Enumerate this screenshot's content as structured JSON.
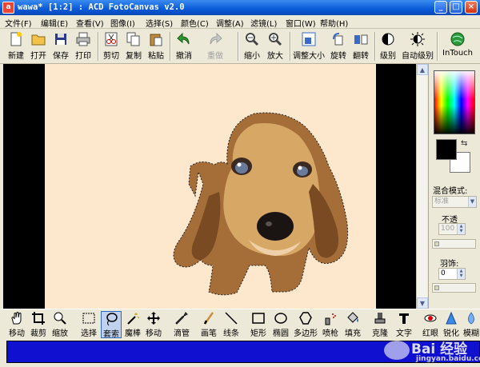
{
  "window": {
    "title": "wawa* [1:2] : ACD FotoCanvas v2.0",
    "app_icon_letter": "a"
  },
  "window_buttons": {
    "minimize": "_",
    "maximize": "□",
    "close": "×"
  },
  "menu": [
    "文件(F)",
    "编辑(E)",
    "查看(V)",
    "图像(I)",
    "选择(S)",
    "颜色(C)",
    "调整(A)",
    "滤镜(L)",
    "窗口(W)",
    "帮助(H)"
  ],
  "toolbar": [
    {
      "label": "新建",
      "icon": "new-file-icon",
      "enabled": true
    },
    {
      "label": "打开",
      "icon": "open-folder-icon",
      "enabled": true
    },
    {
      "label": "保存",
      "icon": "save-disk-icon",
      "enabled": true
    },
    {
      "label": "打印",
      "icon": "printer-icon",
      "enabled": true
    },
    {
      "label": "剪切",
      "icon": "cut-icon",
      "enabled": true
    },
    {
      "label": "复制",
      "icon": "copy-icon",
      "enabled": true
    },
    {
      "label": "粘贴",
      "icon": "paste-icon",
      "enabled": true
    },
    {
      "label": "撤消",
      "icon": "undo-icon",
      "enabled": true
    },
    {
      "label": "重做",
      "icon": "redo-icon",
      "enabled": false
    },
    {
      "label": "缩小",
      "icon": "zoom-out-icon",
      "enabled": true
    },
    {
      "label": "放大",
      "icon": "zoom-in-icon",
      "enabled": true
    },
    {
      "label": "调整大小",
      "icon": "resize-icon",
      "enabled": true
    },
    {
      "label": "旋转",
      "icon": "rotate-icon",
      "enabled": true
    },
    {
      "label": "翻转",
      "icon": "flip-icon",
      "enabled": true
    },
    {
      "label": "级别",
      "icon": "levels-icon",
      "enabled": true
    },
    {
      "label": "自动级别",
      "icon": "auto-levels-icon",
      "enabled": true
    },
    {
      "label": "InTouch",
      "icon": "intouch-globe-icon",
      "enabled": true
    }
  ],
  "right_panel": {
    "blend_mode_label": "混合模式:",
    "blend_mode_value": "标准",
    "opacity_label": "不透",
    "opacity_value": "100",
    "feather_label": "羽饰:",
    "feather_value": "0",
    "fg_color": "#000000",
    "bg_color": "#ffffff"
  },
  "tools": [
    {
      "label": "移动",
      "icon": "hand-icon"
    },
    {
      "label": "裁剪",
      "icon": "crop-icon"
    },
    {
      "label": "缩放",
      "icon": "magnifier-icon"
    },
    {
      "label": "选择",
      "icon": "marquee-select-icon"
    },
    {
      "label": "套索",
      "icon": "lasso-icon",
      "active": true
    },
    {
      "label": "魔棒",
      "icon": "magic-wand-icon"
    },
    {
      "label": "移动",
      "icon": "move-arrows-icon"
    },
    {
      "label": "滴管",
      "icon": "eyedropper-icon"
    },
    {
      "label": "画笔",
      "icon": "brush-icon"
    },
    {
      "label": "线条",
      "icon": "line-icon"
    },
    {
      "label": "矩形",
      "icon": "rectangle-icon"
    },
    {
      "label": "椭圆",
      "icon": "ellipse-icon"
    },
    {
      "label": "多边形",
      "icon": "polygon-icon"
    },
    {
      "label": "喷枪",
      "icon": "airbrush-icon"
    },
    {
      "label": "填充",
      "icon": "fill-bucket-icon"
    },
    {
      "label": "克隆",
      "icon": "clone-stamp-icon"
    },
    {
      "label": "文字",
      "icon": "text-icon"
    },
    {
      "label": "红眼",
      "icon": "red-eye-icon"
    },
    {
      "label": "锐化",
      "icon": "sharpen-icon"
    },
    {
      "label": "模糊",
      "icon": "blur-icon"
    }
  ],
  "watermark": {
    "text": "Bai 经验",
    "subtext": "jingyan.baidu.com"
  },
  "colors": {
    "title_bar": "#0a5ad8",
    "canvas_bg": "#000000",
    "image_bg": "#fde7cd",
    "status_fill": "#1010d0"
  }
}
